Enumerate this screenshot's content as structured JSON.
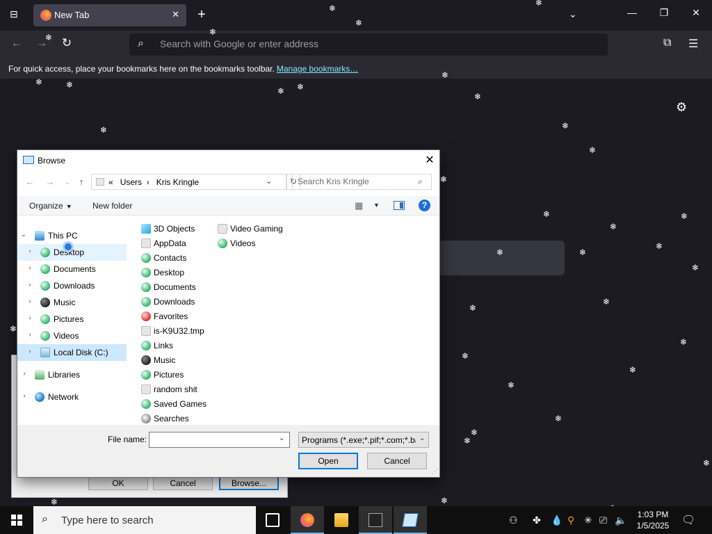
{
  "browser": {
    "tab": {
      "title": "New Tab",
      "close_glyph": "✕"
    },
    "new_tab_glyph": "+",
    "url_placeholder": "Search with Google or enter address",
    "bookmarks_message": "For quick access, place your bookmarks here on the bookmarks toolbar.",
    "bookmarks_link": "Manage bookmarks…",
    "icons": [
      "tab-list-icon",
      "back-icon",
      "forward-icon",
      "reload-icon",
      "search-icon",
      "extensions-icon",
      "menu-icon",
      "settings-icon"
    ]
  },
  "run_dialog": {
    "buttons": [
      "OK",
      "Cancel",
      "Browse..."
    ]
  },
  "browse_dialog": {
    "title": "Browse",
    "address": {
      "prefix": "«",
      "parts": [
        "Users",
        "Kris Kringle"
      ],
      "separator": "›"
    },
    "search_placeholder": "Search Kris Kringle",
    "toolbar": {
      "organize": "Organize",
      "new_folder": "New folder",
      "help": "?"
    },
    "tree": [
      {
        "label": "This PC",
        "expanded": true,
        "icon": "pc-icon"
      },
      {
        "label": "Desktop",
        "icon": "desktop-icon"
      },
      {
        "label": "Documents",
        "icon": "documents-icon"
      },
      {
        "label": "Downloads",
        "icon": "downloads-icon"
      },
      {
        "label": "Music",
        "icon": "music-icon"
      },
      {
        "label": "Pictures",
        "icon": "pictures-icon"
      },
      {
        "label": "Videos",
        "icon": "videos-icon"
      },
      {
        "label": "Local Disk (C:)",
        "icon": "drive-icon",
        "selected": true
      },
      {
        "label": "Libraries",
        "icon": "libraries-icon"
      },
      {
        "label": "Network",
        "icon": "network-icon"
      }
    ],
    "files_col1": [
      {
        "label": "3D Objects",
        "icon": "3d-objects-icon"
      },
      {
        "label": "AppData",
        "icon": "folder-icon"
      },
      {
        "label": "Contacts",
        "icon": "contacts-icon"
      },
      {
        "label": "Desktop",
        "icon": "desktop-icon"
      },
      {
        "label": "Documents",
        "icon": "documents-icon"
      },
      {
        "label": "Downloads",
        "icon": "downloads-icon"
      },
      {
        "label": "Favorites",
        "icon": "favorites-icon"
      },
      {
        "label": "is-K9U32.tmp",
        "icon": "folder-icon"
      },
      {
        "label": "Links",
        "icon": "links-icon"
      },
      {
        "label": "Music",
        "icon": "music-icon"
      },
      {
        "label": "Pictures",
        "icon": "pictures-icon"
      },
      {
        "label": "random shit",
        "icon": "folder-icon"
      },
      {
        "label": "Saved Games",
        "icon": "saved-games-icon"
      },
      {
        "label": "Searches",
        "icon": "searches-icon"
      }
    ],
    "files_col2": [
      {
        "label": "Video Gaming",
        "icon": "folder-icon"
      },
      {
        "label": "Videos",
        "icon": "videos-icon"
      }
    ],
    "file_name_label": "File name:",
    "file_name_value": "",
    "file_type": "Programs (*.exe;*.pif;*.com;*.bat;*.cmd)",
    "open_label": "Open",
    "cancel_label": "Cancel"
  },
  "taskbar": {
    "search_placeholder": "Type here to search",
    "apps": [
      "task-view-icon",
      "firefox-icon",
      "file-explorer-icon",
      "command-prompt-icon",
      "run-icon"
    ],
    "time": "1:03 PM",
    "date": "1/5/2025"
  },
  "colors": {
    "browser_bg": "#1c1b22",
    "toolbar_bg": "#2b2a33",
    "link": "#80ebff",
    "selection": "#cce8ff",
    "accent": "#0078d7"
  }
}
